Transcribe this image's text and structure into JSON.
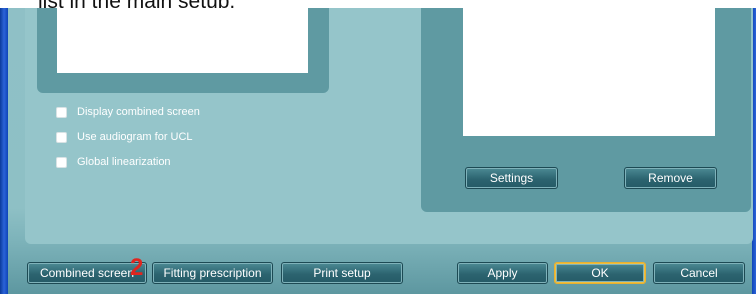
{
  "caption": "list in the main setup.",
  "options": [
    {
      "label": "Display combined screen",
      "checked": false
    },
    {
      "label": "Use audiogram for UCL",
      "checked": false
    },
    {
      "label": "Global linearization",
      "checked": false
    }
  ],
  "right_panel": {
    "settings_label": "Settings",
    "remove_label": "Remove"
  },
  "footer": {
    "combined_screen_label": "Combined screen",
    "fitting_prescription_label": "Fitting prescription",
    "print_setup_label": "Print setup",
    "apply_label": "Apply",
    "ok_label": "OK",
    "cancel_label": "Cancel"
  },
  "annotation": {
    "marker": "2",
    "color": "#e0261f"
  }
}
